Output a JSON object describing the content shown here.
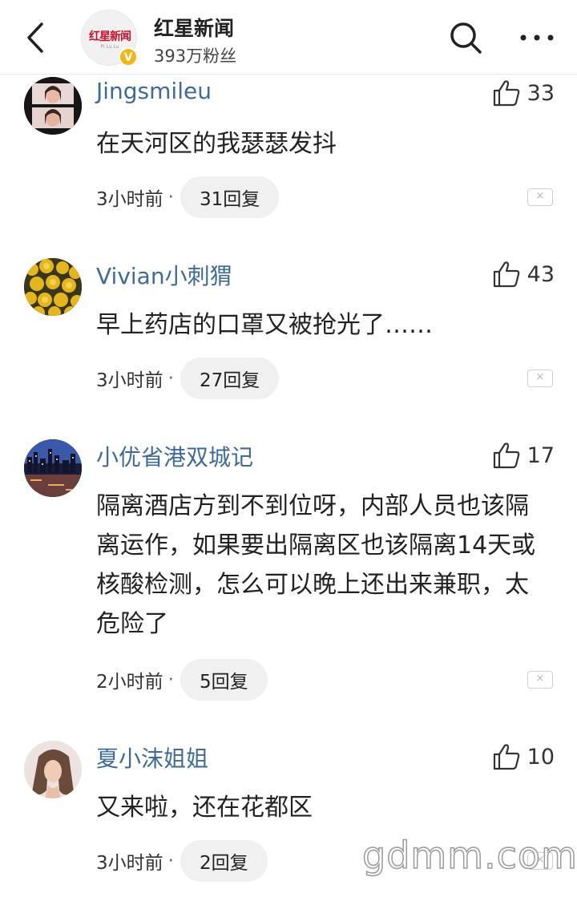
{
  "header": {
    "account_name": "红星新闻",
    "followers": "393万粉丝",
    "logo_text": "红星新闻",
    "logo_sub": "Pi Lu Lu",
    "verified_mark": "V"
  },
  "comments": [
    {
      "username": "Jingsmileu",
      "likes": "33",
      "text": "在天河区的我瑟瑟发抖",
      "time": "3小时前",
      "replies": "31回复"
    },
    {
      "username": "Vivian小刺猬",
      "likes": "43",
      "text": "早上药店的口罩又被抢光了……",
      "time": "3小时前",
      "replies": "27回复"
    },
    {
      "username": "小优省港双城记",
      "likes": "17",
      "text": "隔离酒店方到不到位呀，内部人员也该隔离运作，如果要出隔离区也该隔离14天或核酸检测，怎么可以晚上还出来兼职，太危险了",
      "time": "2小时前",
      "replies": "5回复"
    },
    {
      "username": "夏小沫姐姐",
      "likes": "10",
      "text": "又来啦，还在花都区",
      "time": "3小时前",
      "replies": "2回复"
    }
  ],
  "separator": "·",
  "close_symbol": "×",
  "watermark": "gdmm.com",
  "icons": {
    "back": "chevron-left-icon",
    "search": "search-icon",
    "more": "more-dots-icon",
    "like": "thumbs-up-icon",
    "close": "close-icon"
  },
  "colors": {
    "username": "#3f6b9a",
    "verified": "#f3b616",
    "brand_red": "#c8102e",
    "reply_pill": "#f0f0f0"
  }
}
